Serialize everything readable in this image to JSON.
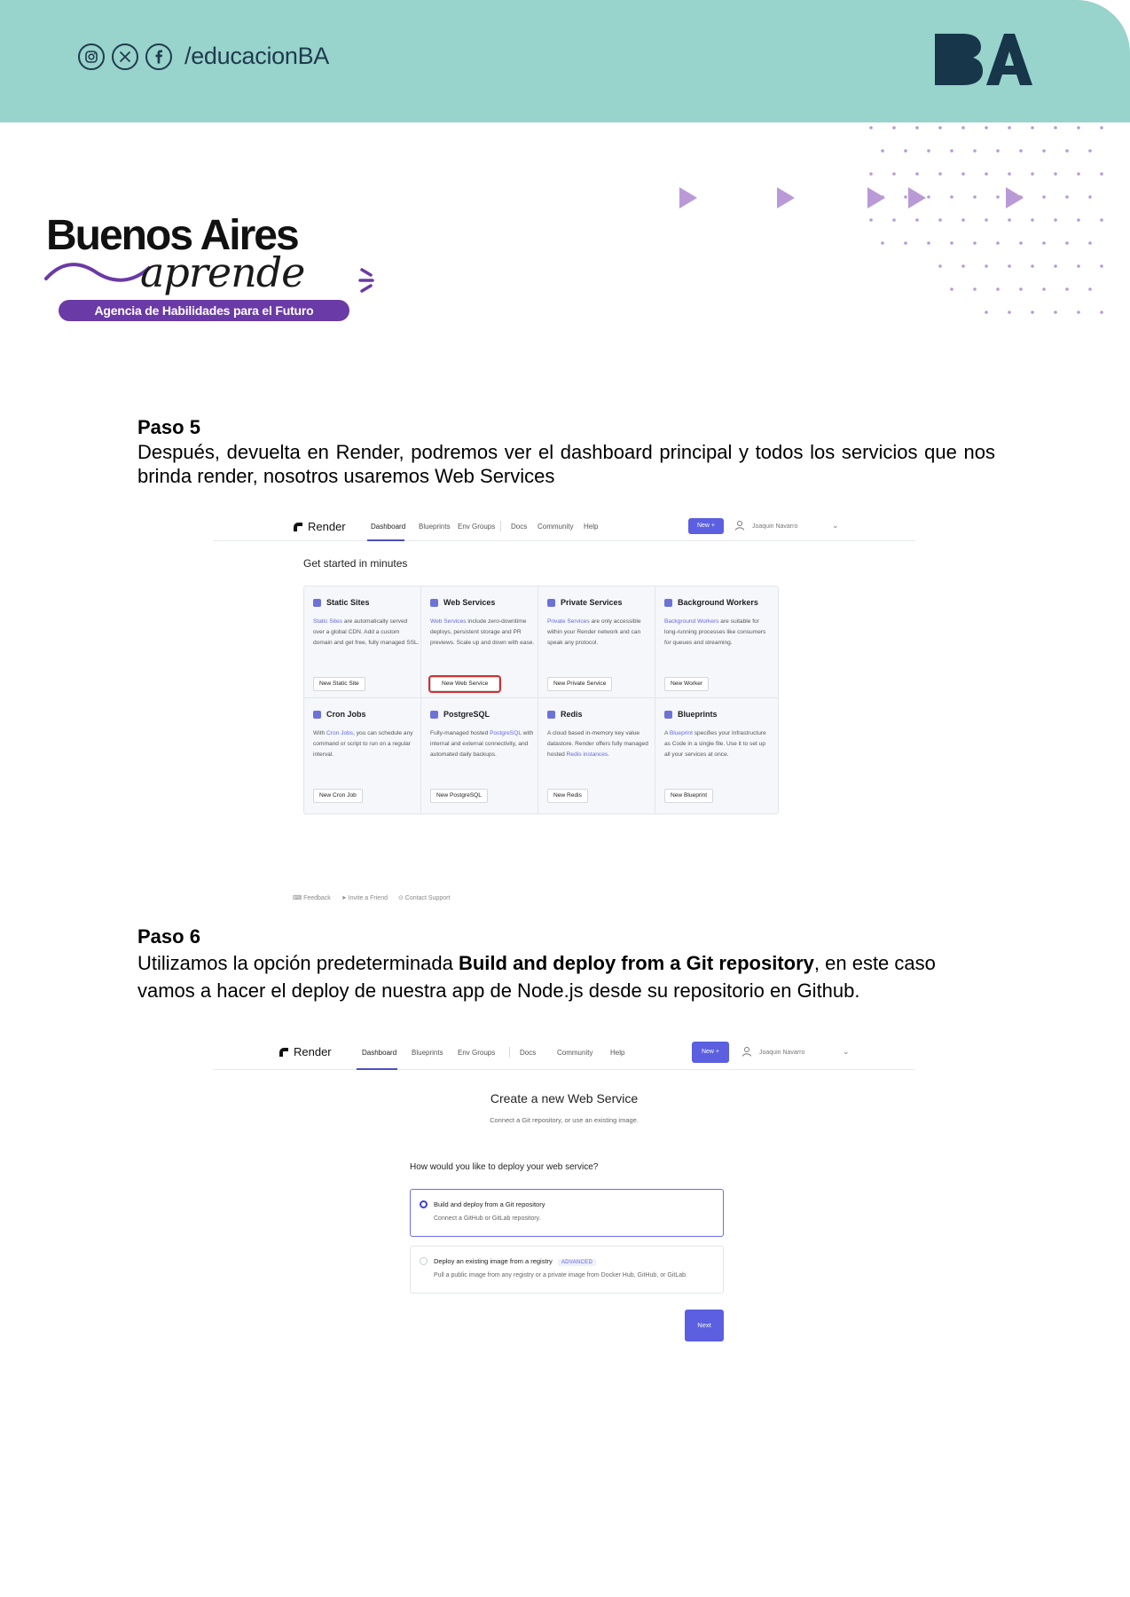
{
  "header": {
    "social_handle": "/educacionBA",
    "social_icons": [
      "instagram-icon",
      "x-icon",
      "facebook-icon"
    ],
    "logo_text": "BA",
    "band_color": "#98d3cc",
    "logo_color": "#17364a"
  },
  "brand": {
    "title": "Buenos Aires",
    "script": "aprende",
    "tagline": "Agencia de Habilidades para el Futuro",
    "accent_color": "#6a3aa6"
  },
  "step5": {
    "title": "Paso 5",
    "text": "Después, devuelta en Render, podremos ver el dashboard principal y todos los servicios que nos brinda render, nosotros usaremos Web Services"
  },
  "dashboard": {
    "brand": "Render",
    "nav": [
      "Dashboard",
      "Blueprints",
      "Env Groups",
      "Docs",
      "Community",
      "Help"
    ],
    "new_button": "New +",
    "user": "Joaquin Navarro",
    "heading": "Get started in minutes",
    "cards": [
      {
        "title": "Static Sites",
        "link": "Static Sites",
        "body": " are automatically served over a global CDN. Add a custom domain and get free, fully managed SSL.",
        "button": "New Static Site",
        "highlight": false
      },
      {
        "title": "Web Services",
        "link": "Web Services",
        "body": " include zero-downtime deploys, persistent storage and PR previews. Scale up and down with ease.",
        "button": "New Web Service",
        "highlight": true
      },
      {
        "title": "Private Services",
        "link": "Private Services",
        "body": " are only accessible within your Render network and can speak any protocol.",
        "button": "New Private Service",
        "highlight": false
      },
      {
        "title": "Background Workers",
        "link": "Background Workers",
        "body": " are suitable for long-running processes like consumers for queues and streaming.",
        "button": "New Worker",
        "highlight": false
      },
      {
        "title": "Cron Jobs",
        "prefix": "With ",
        "link": "Cron Jobs",
        "body": ", you can schedule any command or script to run on a regular interval.",
        "button": "New Cron Job",
        "highlight": false
      },
      {
        "title": "PostgreSQL",
        "prefix": "Fully-managed hosted ",
        "link": "PostgreSQL",
        "body": " with internal and external connectivity, and automated daily backups.",
        "button": "New PostgreSQL",
        "highlight": false
      },
      {
        "title": "Redis",
        "prefix": "A cloud based in-memory key value datastore. Render offers fully managed hosted ",
        "link": "Redis instances",
        "body": ".",
        "button": "New Redis",
        "highlight": false
      },
      {
        "title": "Blueprints",
        "prefix": "A ",
        "link": "Blueprint",
        "body": " specifies your Infrastructure as Code in a single file. Use it to set up all your services at once.",
        "button": "New Blueprint",
        "highlight": false
      }
    ],
    "footer": [
      "Feedback",
      "Invite a Friend",
      "Contact Support"
    ]
  },
  "step6": {
    "title": "Paso 6",
    "text_before": "Utilizamos la opción predeterminada ",
    "text_bold": "Build and deploy from a Git repository",
    "text_after": ", en este caso vamos a hacer el deploy de nuestra app de Node.js desde su repositorio en Github."
  },
  "create": {
    "title_prefix": "Create a new ",
    "title_strong": "Web Service",
    "subtitle": "Connect a Git repository, or use an existing image.",
    "question": "How would you like to deploy your web service?",
    "option1_title": "Build and deploy from a Git repository",
    "option1_desc": "Connect a GitHub or GitLab repository.",
    "option2_title": "Deploy an existing image from a registry",
    "option2_badge": "ADVANCED",
    "option2_desc": "Pull a public image from any registry or a private image from Docker Hub, GitHub, or GitLab.",
    "next": "Next"
  }
}
